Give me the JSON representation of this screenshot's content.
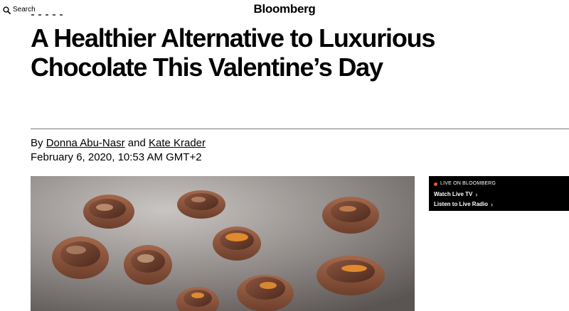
{
  "header": {
    "search_label": "Search",
    "logo": "Bloomberg"
  },
  "article": {
    "headline": "A Healthier Alternative to Luxurious Chocolate This Valentine’s Day",
    "byline_prefix": "By",
    "authors": [
      "Donna Abu-Nasr",
      "Kate Krader"
    ],
    "author_joiner": "and",
    "date": "February 6, 2020, 10:53 AM GMT+2"
  },
  "live_box": {
    "label": "LIVE ON BLOOMBERG",
    "links": [
      "Watch Live TV",
      "Listen to Live Radio"
    ]
  },
  "icons": {
    "search": "search-icon",
    "live_dot": "live-dot-icon",
    "chevron": "chevron-right-icon"
  },
  "colors": {
    "live_box_bg": "#000000",
    "live_dot": "#e2621b",
    "divider": "#7a7a7a"
  }
}
